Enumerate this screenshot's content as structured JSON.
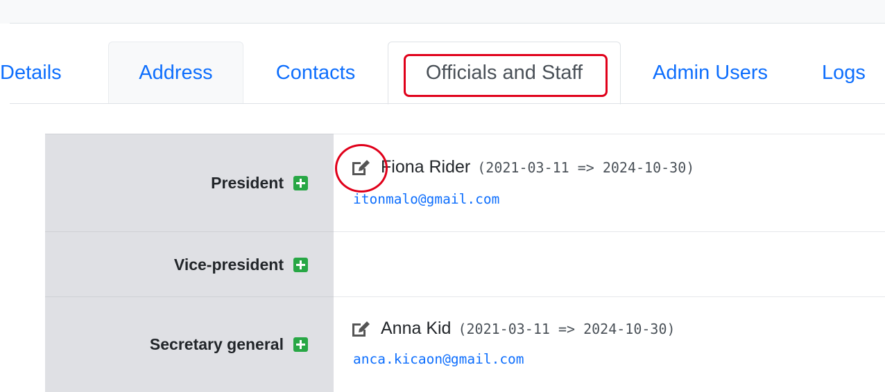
{
  "tabs": [
    {
      "label": "Details",
      "state": "normal"
    },
    {
      "label": "Address",
      "state": "hover"
    },
    {
      "label": "Contacts",
      "state": "normal"
    },
    {
      "label": "Officials and Staff",
      "state": "active"
    },
    {
      "label": "Admin Users",
      "state": "normal"
    },
    {
      "label": "Logs",
      "state": "normal"
    }
  ],
  "officials": [
    {
      "role": "President",
      "add_icon": "plus-square-icon",
      "person": {
        "name": "Fiona Rider",
        "dates": "(2021-03-11 => 2024-10-30)",
        "email": "itonmalo@gmail.com",
        "edit_icon": "edit-icon"
      }
    },
    {
      "role": "Vice-president",
      "add_icon": "plus-square-icon",
      "person": null
    },
    {
      "role": "Secretary general",
      "add_icon": "plus-square-icon",
      "person": {
        "name": "Anna Kid",
        "dates": "(2021-03-11 => 2024-10-30)",
        "email": "anca.kicaon@gmail.com",
        "edit_icon": "edit-icon"
      }
    }
  ],
  "colors": {
    "link": "#0d6efd",
    "add_icon": "#28a745",
    "label_background": "#dfe0e4",
    "annotation_highlight": "#e0001a"
  }
}
